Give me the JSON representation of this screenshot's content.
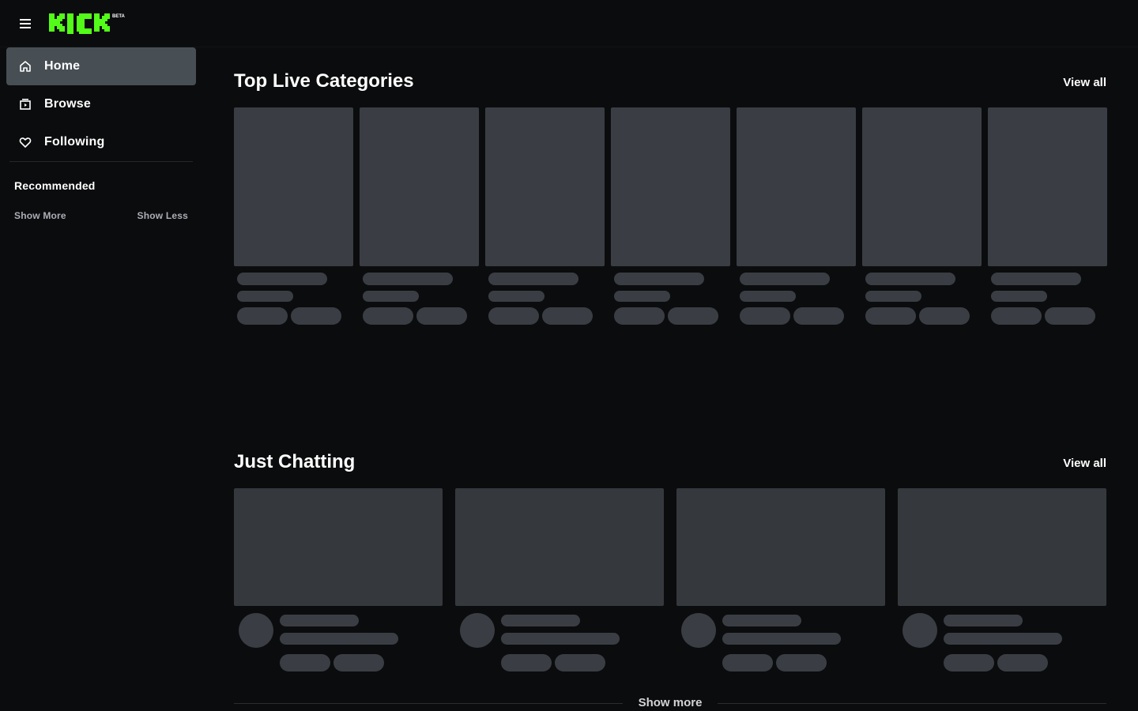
{
  "app": {
    "logo_text": "KICK",
    "logo_badge": "BETA",
    "brand_color": "#53fc18"
  },
  "sidebar": {
    "items": [
      {
        "label": "Home",
        "icon": "home-icon",
        "active": true
      },
      {
        "label": "Browse",
        "icon": "browse-icon",
        "active": false
      },
      {
        "label": "Following",
        "icon": "heart-icon",
        "active": false
      }
    ],
    "recommended_heading": "Recommended",
    "show_more": "Show More",
    "show_less": "Show Less"
  },
  "sections": {
    "top_categories": {
      "title": "Top Live Categories",
      "view_all": "View all",
      "placeholder_cards": 7
    },
    "just_chatting": {
      "title": "Just Chatting",
      "view_all": "View all",
      "placeholder_cards": 4
    }
  },
  "show_more": "Show more",
  "colors": {
    "background": "#0b0c0d",
    "active_nav": "#474f54",
    "skeleton": "#3a3e44"
  }
}
